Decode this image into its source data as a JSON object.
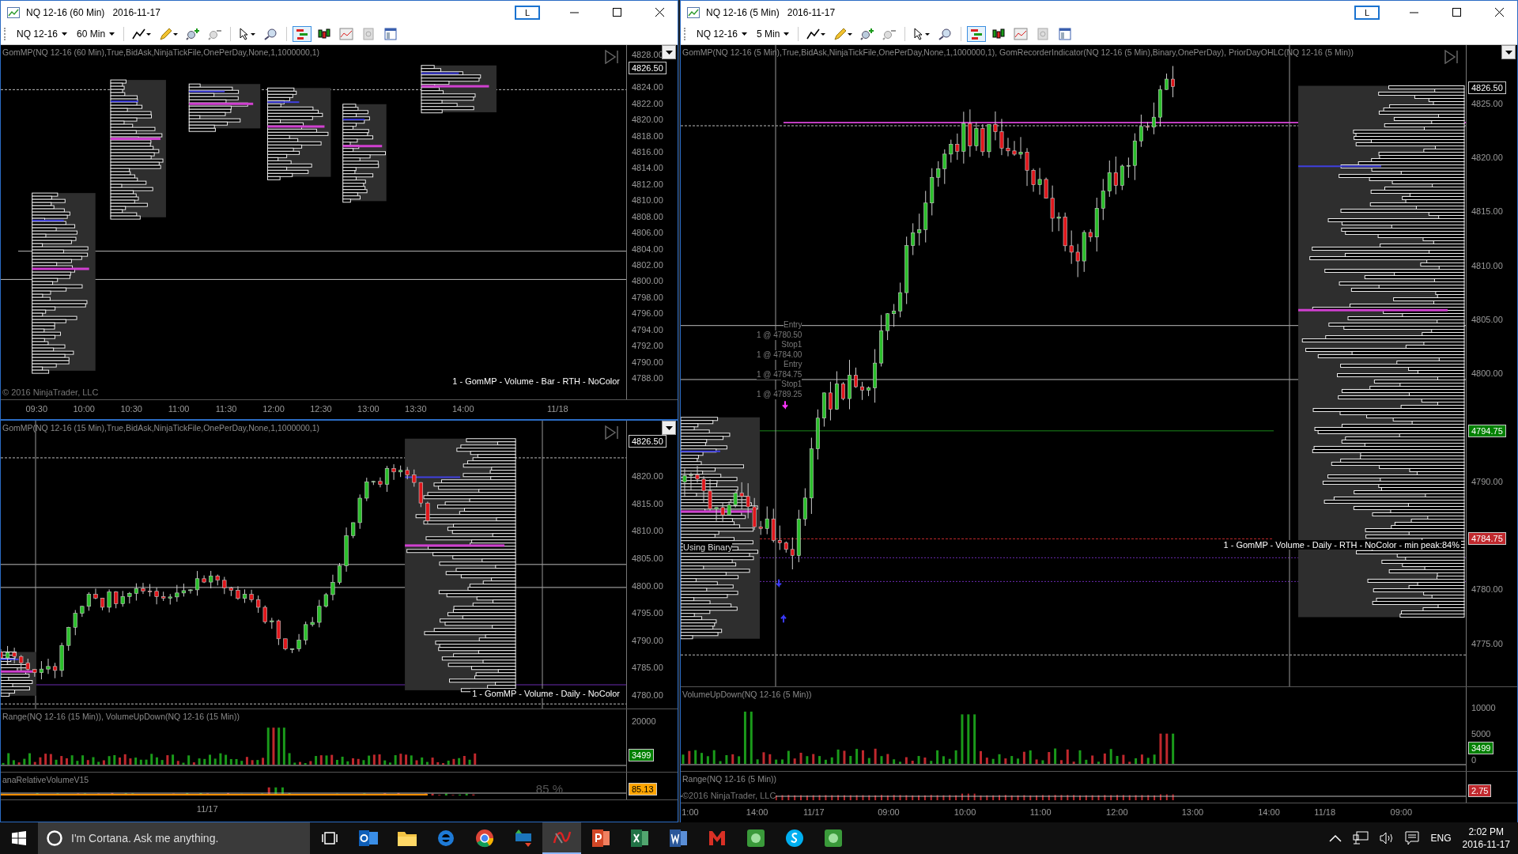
{
  "windows": [
    {
      "title": "NQ 12-16 (60 Min)",
      "date": "2016-11-17",
      "link_button": "L",
      "instrument": "NQ 12-16",
      "interval": "60 Min",
      "chart_tools": [
        {
          "selected": true
        },
        {
          "selected": false
        },
        {
          "selected": false
        },
        {
          "selected": false
        },
        {
          "selected": false
        }
      ],
      "panels": [
        {
          "kind": "profile_price",
          "indicator_label": "GomMP(NQ 12-16 (60 Min),True,BidAsk,NinjaTickFile,OnePerDay,None,1,1000000,1)",
          "yticks": [
            "4828.00",
            "4824.00",
            "4822.00",
            "4820.00",
            "4818.00",
            "4816.00",
            "4814.00",
            "4812.00",
            "4810.00",
            "4808.00",
            "4806.00",
            "4804.00",
            "4802.00",
            "4800.00",
            "4798.00",
            "4796.00",
            "4794.00",
            "4792.00",
            "4790.00",
            "4788.00"
          ],
          "badges": [
            {
              "text": "4826.50",
              "color": "#000000"
            }
          ],
          "note": "1 - GomMP  - Volume - Bar - RTH - NoColor",
          "copyright": "© 2016 NinjaTrader, LLC"
        }
      ],
      "xticks": [
        "09:30",
        "10:00",
        "10:30",
        "11:00",
        "11:30",
        "12:00",
        "12:30",
        "13:00",
        "13:30",
        "14:00",
        "11/18"
      ]
    },
    {
      "panels": [
        {
          "kind": "candle_price",
          "indicator_label": "GomMP(NQ 12-16 (15 Min),True,BidAsk,NinjaTickFile,OnePerDay,None,1,1000000,1)",
          "yticks": [
            "4820.00",
            "4815.00",
            "4810.00",
            "4805.00",
            "4800.00",
            "4795.00",
            "4790.00",
            "4785.00",
            "4780.00"
          ],
          "badges": [
            {
              "text": "4826.50",
              "color": "#000000"
            }
          ],
          "note": "1 - GomMP - Volume - Daily - NoColor"
        },
        {
          "kind": "volume",
          "indicator_label": "Range(NQ 12-16 (15 Min)), VolumeUpDown(NQ 12-16 (15 Min))",
          "yticks": [
            "20000"
          ],
          "badges": [
            {
              "text": "3499",
              "color": "#008000"
            }
          ]
        },
        {
          "kind": "relative_volume",
          "indicator_label": "anaRelativeVolumeV15",
          "reading": "85 %",
          "badges": [
            {
              "text": "85.13",
              "color": "#ffa500"
            }
          ]
        }
      ],
      "xticks": [
        "11/17"
      ]
    },
    {
      "title": "NQ 12-16 (5 Min)",
      "date": "2016-11-17",
      "link_button": "L",
      "instrument": "NQ 12-16",
      "interval": "5 Min",
      "chart_tools": [
        {
          "selected": true
        },
        {
          "selected": false
        },
        {
          "selected": false
        },
        {
          "selected": false
        },
        {
          "selected": false
        }
      ],
      "panels": [
        {
          "kind": "candle_price",
          "indicator_label": "GomMP(NQ 12-16 (5 Min),True,BidAsk,NinjaTickFile,OnePerDay,None,1,1000000,1), GomRecorderIndicator(NQ 12-16 (5 Min),Binary,OnePerDay), PriorDayOHLC(NQ 12-16 (5 Min))",
          "yticks": [
            "4825.00",
            "4820.00",
            "4815.00",
            "4810.00",
            "4805.00",
            "4800.00",
            "4790.00",
            "4780.00",
            "4775.00"
          ],
          "badges": [
            {
              "text": "4826.50",
              "color": "#000000"
            },
            {
              "text": "4794.75",
              "color": "#008000"
            },
            {
              "text": "4784.75",
              "color": "#c0282d"
            }
          ],
          "trade_markers": [
            "Entry",
            "1 @ 4780.50",
            "Stop1",
            "1 @ 4784.00",
            "Entry",
            "1 @ 4784.75",
            "Stop1",
            "1 @ 4789.25"
          ],
          "status": "Using Binary",
          "note": "1 - GomMP - Volume - Daily - RTH - NoColor - min peak:84%"
        },
        {
          "kind": "volume",
          "indicator_label": "VolumeUpDown(NQ 12-16 (5 Min))",
          "yticks": [
            "10000",
            "5000",
            "0"
          ],
          "badges": [
            {
              "text": "3499",
              "color": "#008000"
            }
          ]
        },
        {
          "kind": "range",
          "indicator_label": "Range(NQ 12-16 (5 Min))",
          "copyright": "©2016 NinjaTrader, LLC",
          "badges": [
            {
              "text": "2.75",
              "color": "#c0282d"
            }
          ]
        }
      ],
      "xticks": [
        "1:00",
        "14:00",
        "11/17",
        "09:00",
        "10:00",
        "11:00",
        "12:00",
        "13:00",
        "14:00",
        "11/18",
        "09:00"
      ]
    }
  ],
  "taskbar": {
    "search": {
      "placeholder": "I'm Cortana. Ask me anything."
    },
    "apps": [
      {
        "kind": "task-view",
        "selected": false
      },
      {
        "kind": "mail",
        "selected": false
      },
      {
        "kind": "folder",
        "selected": false
      },
      {
        "kind": "browser-e",
        "selected": false
      },
      {
        "kind": "browser-circle",
        "selected": false
      },
      {
        "kind": "tws",
        "selected": false
      },
      {
        "kind": "trading",
        "selected": true
      },
      {
        "kind": "slides",
        "selected": false
      },
      {
        "kind": "sheet",
        "selected": false
      },
      {
        "kind": "doc",
        "selected": false
      },
      {
        "kind": "mail-red",
        "selected": false
      },
      {
        "kind": "green-app",
        "selected": false
      },
      {
        "kind": "chat",
        "selected": false
      },
      {
        "kind": "green-app",
        "selected": false
      }
    ],
    "language": "ENG",
    "time": "2:02 PM",
    "date": "2016-11-17"
  }
}
